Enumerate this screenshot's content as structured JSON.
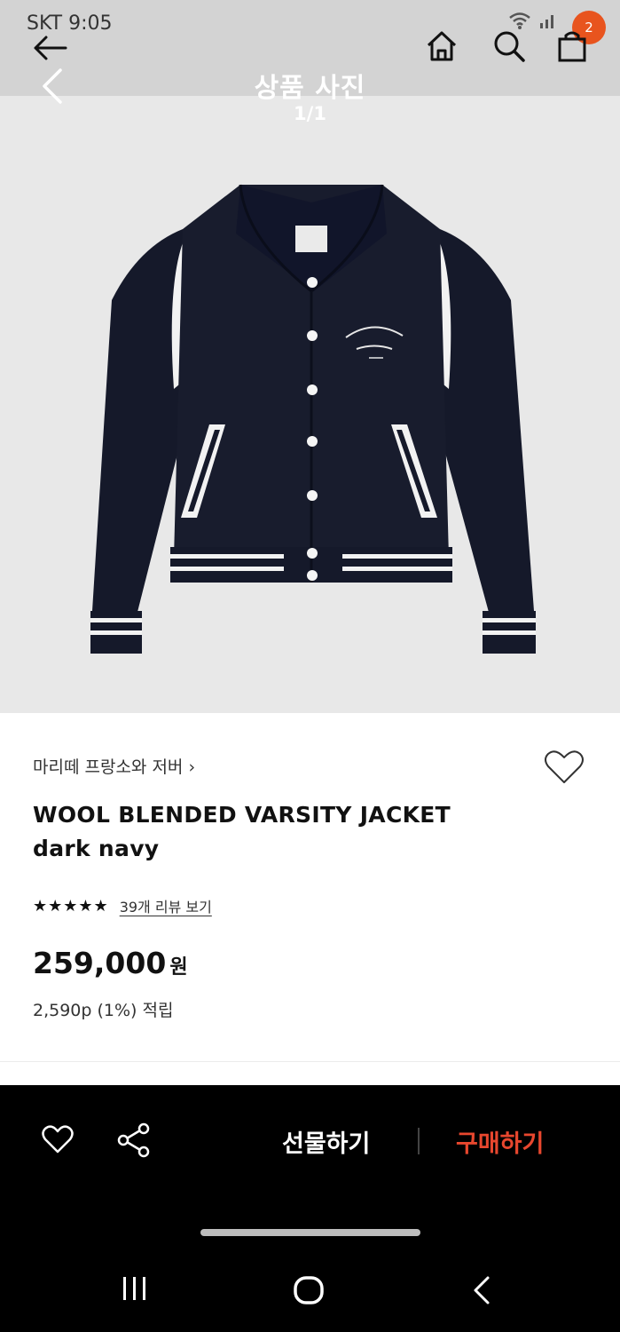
{
  "status_bar": {
    "carrier_time": "SKT 9:05",
    "notification_count": "2"
  },
  "viewer": {
    "title": "상품 사진",
    "counter": "1/1"
  },
  "product": {
    "brand": "마리떼 프랑소와 저버",
    "name_line1": "WOOL BLENDED VARSITY JACKET",
    "name_line2": "dark navy",
    "rating_stars": 5,
    "stars_text": "★★★★★",
    "review_link": "39개 리뷰 보기",
    "price": "259,000",
    "currency": "원",
    "points": "2,590p (1%) 적립"
  },
  "bottom_bar": {
    "gift_label": "선물하기",
    "buy_label": "구매하기"
  },
  "colors": {
    "buy_accent": "#e8472e",
    "badge": "#e8541e",
    "jacket_navy": "#15192a",
    "bottom_bar_bg": "#000000"
  },
  "icons": [
    "back-arrow-icon",
    "home-icon",
    "search-icon",
    "cart-icon",
    "viewer-back-chevron-icon",
    "wifi-icon",
    "signal-icon",
    "heart-icon",
    "share-icon",
    "recents-icon",
    "home-circle-icon",
    "nav-back-icon"
  ]
}
